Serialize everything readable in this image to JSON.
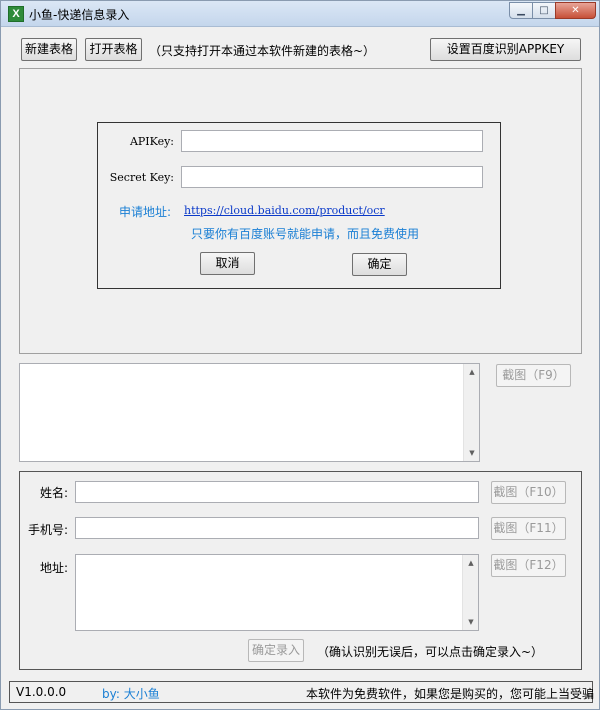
{
  "window": {
    "title": "小鱼-快递信息录入",
    "icon_glyph": "X",
    "minimize_glyph": "▁",
    "maximize_glyph": "□",
    "close_glyph": "✕"
  },
  "toolbar": {
    "new_table": "新建表格",
    "open_table": "打开表格",
    "hint": "（只支持打开本通过本软件新建的表格~）",
    "set_apikey": "设置百度识别APPKEY"
  },
  "api_dialog": {
    "apikey_label": "APIKey:",
    "apikey_value": "",
    "secret_label": "Secret Key:",
    "secret_value": "",
    "apply_label": "申请地址:",
    "apply_url": "https://cloud.baidu.com/product/ocr",
    "note": "只要你有百度账号就能申请，而且免费使用",
    "cancel": "取消",
    "confirm": "确定"
  },
  "ocr": {
    "screenshot_f9": "截图（F9）",
    "text_value": ""
  },
  "form": {
    "name_label": "姓名:",
    "name_value": "",
    "screenshot_f10": "截图（F10）",
    "phone_label": "手机号:",
    "phone_value": "",
    "screenshot_f11": "截图（F11）",
    "address_label": "地址:",
    "address_value": "",
    "screenshot_f12": "截图（F12）",
    "confirm_entry": "确定录入",
    "confirm_hint": "（确认识别无误后，可以点击确定录入~）"
  },
  "scroll": {
    "up_glyph": "▲",
    "down_glyph": "▼"
  },
  "status": {
    "version": "V1.0.0.0",
    "author": "by: 大小鱼",
    "notice": "本软件为免费软件，如果您是购买的，您可能上当受骗"
  },
  "colors": {
    "link": "#0a39c9",
    "accent_blue": "#1a7fd4"
  }
}
